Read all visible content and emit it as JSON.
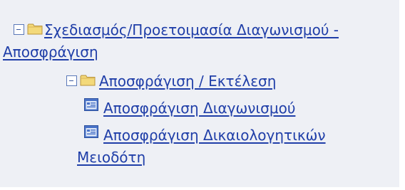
{
  "tree": {
    "root": {
      "label_line1": "Σχεδιασμός/Προετοιμασία Διαγωνισμού -",
      "label_line2": "Αποσφράγιση",
      "child": {
        "label": "Αποσφράγιση / Εκτέλεση",
        "items": [
          {
            "label_line1": "Αποσφράγιση Διαγωνισμού"
          },
          {
            "label_line1": "Αποσφράγιση Δικαιολογητικών",
            "label_line2": "Μειοδότη"
          }
        ]
      }
    }
  },
  "colors": {
    "panel_background": "#eef0f5",
    "link": "#1f3ea8",
    "folder": "#f3d97a",
    "toggle_border": "#5a78b8"
  },
  "icons": {
    "toggle": "collapse-minus-icon",
    "folder": "folder-icon",
    "page": "page-window-icon"
  }
}
